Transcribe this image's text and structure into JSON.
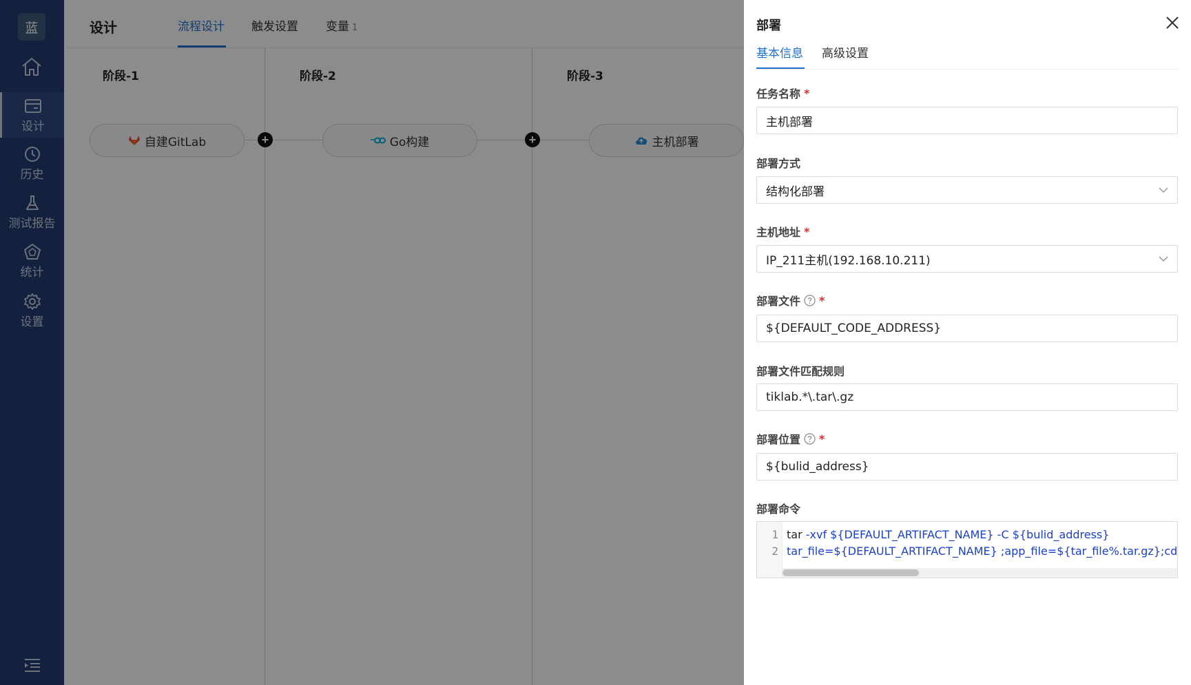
{
  "sidebar": {
    "logo": "蓝",
    "items": [
      {
        "label": "设计",
        "icon": "design-icon",
        "active": true
      },
      {
        "label": "历史",
        "icon": "clock-icon",
        "active": false
      },
      {
        "label": "测试报告",
        "icon": "flask-icon",
        "active": false
      },
      {
        "label": "统计",
        "icon": "chart-icon",
        "active": false
      },
      {
        "label": "设置",
        "icon": "gear-icon",
        "active": false
      }
    ]
  },
  "header": {
    "title": "设计",
    "tabs": [
      {
        "label": "流程设计",
        "active": true
      },
      {
        "label": "触发设置",
        "active": false
      },
      {
        "label": "变量",
        "badge": "1",
        "active": false
      }
    ]
  },
  "pipeline": {
    "stages": [
      {
        "title": "阶段-1",
        "job": "自建GitLab",
        "icon": "gitlab-icon"
      },
      {
        "title": "阶段-2",
        "job": "Go构建",
        "icon": "go-icon"
      },
      {
        "title": "阶段-3",
        "job": "主机部署",
        "icon": "cloud-icon"
      }
    ]
  },
  "drawer": {
    "title": "部署",
    "tabs": [
      {
        "label": "基本信息",
        "active": true
      },
      {
        "label": "高级设置",
        "active": false
      }
    ],
    "fields": {
      "task_name": {
        "label": "任务名称",
        "required": true,
        "value": "主机部署"
      },
      "deploy_mode": {
        "label": "部署方式",
        "value": "结构化部署"
      },
      "host": {
        "label": "主机地址",
        "required": true,
        "value": "IP_211主机(192.168.10.211)"
      },
      "deploy_file": {
        "label": "部署文件",
        "required": true,
        "value": "${DEFAULT_CODE_ADDRESS}"
      },
      "match_rule": {
        "label": "部署文件匹配规则",
        "value": "tiklab.*\\.tar\\.gz"
      },
      "deploy_location": {
        "label": "部署位置",
        "required": true,
        "value": "${bulid_address}"
      },
      "command": {
        "label": "部署命令",
        "lines": [
          {
            "num": "1",
            "cmd": "tar",
            "rest": " -xvf  ${DEFAULT_ARTIFACT_NAME} -C ${bulid_address}"
          },
          {
            "num": "2",
            "cmd": "",
            "rest": "tar_file=${DEFAULT_ARTIFACT_NAME} ;app_file=${tar_file%.tar.gz};cd ${bul"
          }
        ]
      }
    }
  },
  "colors": {
    "accent": "#1f6fd0",
    "sidebar": "#233c72",
    "required": "#e02b2b"
  }
}
